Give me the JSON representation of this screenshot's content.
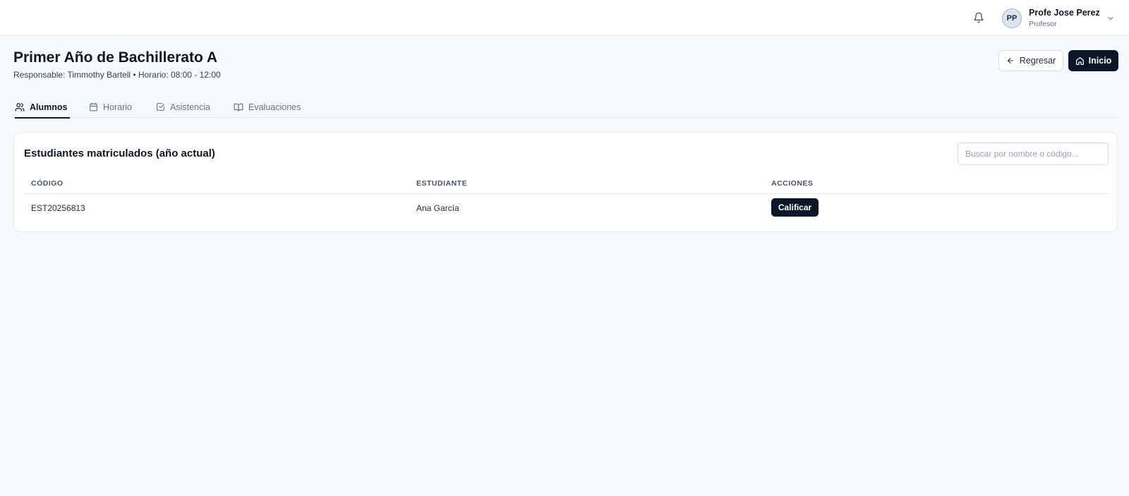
{
  "topbar": {
    "icons": {
      "notifications": "bell-icon",
      "menu": "chevron-down-icon"
    },
    "user": {
      "initials": "PP",
      "name": "Profe Jose Perez",
      "role": "Profesor"
    }
  },
  "header": {
    "title": "Primer Año de Bachillerato A",
    "subtitle": "Responsable: Timmothy Bartell • Horario: 08:00 - 12:00",
    "back_label": "Regresar",
    "home_label": "Inicio",
    "icons": {
      "back": "arrow-left-icon",
      "home": "home-icon"
    }
  },
  "tabs": [
    {
      "label": "Alumnos",
      "icon": "users-icon",
      "active": true
    },
    {
      "label": "Horario",
      "icon": "calendar-icon",
      "active": false
    },
    {
      "label": "Asistencia",
      "icon": "checkbox-icon",
      "active": false
    },
    {
      "label": "Evaluaciones",
      "icon": "book-open-icon",
      "active": false
    }
  ],
  "students": {
    "title": "Estudiantes matriculados (año actual)",
    "search_placeholder": "Buscar por nombre o código...",
    "search_value": "",
    "columns": [
      "CÓDIGO",
      "ESTUDIANTE",
      "ACCIONES"
    ],
    "rows": [
      {
        "code": "EST20256813",
        "name": "Ana García",
        "action_label": "Calificar"
      }
    ]
  },
  "colors": {
    "primary": "#0b1628",
    "background": "#f7fafc",
    "border": "#e5e9ef",
    "muted_text": "#64748b"
  }
}
